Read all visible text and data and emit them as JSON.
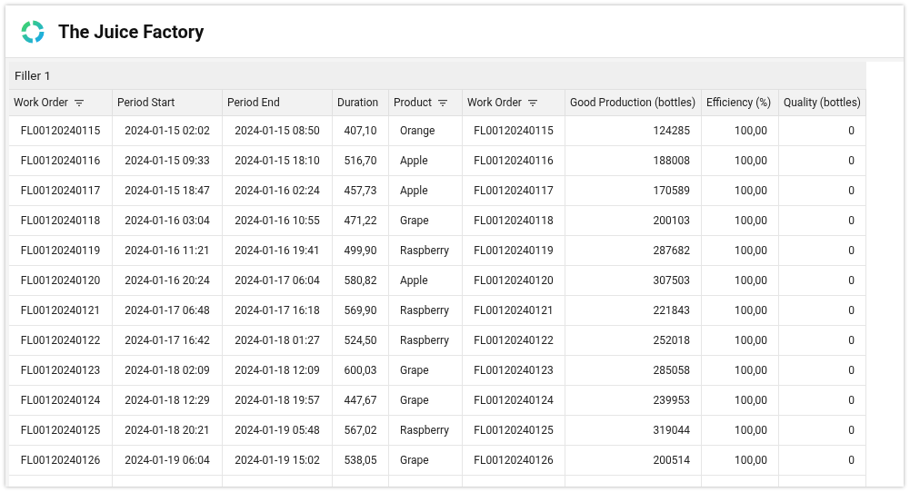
{
  "app": {
    "title": "The Juice Factory"
  },
  "table": {
    "group": "Filler 1",
    "columns": [
      {
        "label": "Work Order",
        "filterable": true
      },
      {
        "label": "Period Start",
        "filterable": false
      },
      {
        "label": "Period End",
        "filterable": false
      },
      {
        "label": "Duration",
        "filterable": false
      },
      {
        "label": "Product",
        "filterable": true
      },
      {
        "label": "Work Order",
        "filterable": true
      },
      {
        "label": "Good Production (bottles)",
        "filterable": false
      },
      {
        "label": "Efficiency (%)",
        "filterable": false
      },
      {
        "label": "Quality (bottles)",
        "filterable": false
      }
    ],
    "rows": [
      [
        "FL00120240115",
        "2024-01-15 02:02",
        "2024-01-15 08:50",
        "407,10",
        "Orange",
        "FL00120240115",
        "124285",
        "100,00",
        "0"
      ],
      [
        "FL00120240116",
        "2024-01-15 09:33",
        "2024-01-15 18:10",
        "516,70",
        "Apple",
        "FL00120240116",
        "188008",
        "100,00",
        "0"
      ],
      [
        "FL00120240117",
        "2024-01-15 18:47",
        "2024-01-16 02:24",
        "457,73",
        "Apple",
        "FL00120240117",
        "170589",
        "100,00",
        "0"
      ],
      [
        "FL00120240118",
        "2024-01-16 03:04",
        "2024-01-16 10:55",
        "471,22",
        "Grape",
        "FL00120240118",
        "200103",
        "100,00",
        "0"
      ],
      [
        "FL00120240119",
        "2024-01-16 11:21",
        "2024-01-16 19:41",
        "499,90",
        "Raspberry",
        "FL00120240119",
        "287682",
        "100,00",
        "0"
      ],
      [
        "FL00120240120",
        "2024-01-16 20:24",
        "2024-01-17 06:04",
        "580,82",
        "Apple",
        "FL00120240120",
        "307503",
        "100,00",
        "0"
      ],
      [
        "FL00120240121",
        "2024-01-17 06:48",
        "2024-01-17 16:18",
        "569,90",
        "Raspberry",
        "FL00120240121",
        "221843",
        "100,00",
        "0"
      ],
      [
        "FL00120240122",
        "2024-01-17 16:42",
        "2024-01-18 01:27",
        "524,50",
        "Raspberry",
        "FL00120240122",
        "252018",
        "100,00",
        "0"
      ],
      [
        "FL00120240123",
        "2024-01-18 02:09",
        "2024-01-18 12:09",
        "600,03",
        "Grape",
        "FL00120240123",
        "285058",
        "100,00",
        "0"
      ],
      [
        "FL00120240124",
        "2024-01-18 12:29",
        "2024-01-18 19:57",
        "447,67",
        "Grape",
        "FL00120240124",
        "239953",
        "100,00",
        "0"
      ],
      [
        "FL00120240125",
        "2024-01-18 20:21",
        "2024-01-19 05:48",
        "567,02",
        "Raspberry",
        "FL00120240125",
        "319044",
        "100,00",
        "0"
      ],
      [
        "FL00120240126",
        "2024-01-19 06:04",
        "2024-01-19 15:02",
        "538,05",
        "Grape",
        "FL00120240126",
        "200514",
        "100,00",
        "0"
      ]
    ]
  }
}
